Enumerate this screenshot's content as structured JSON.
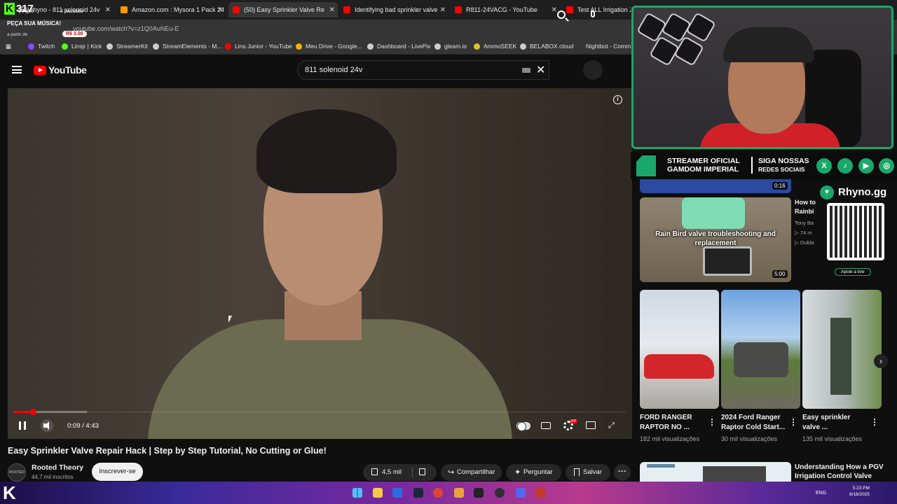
{
  "browser": {
    "tabs": [
      {
        "label": "(50) rhyno - 811 solenoid 24v",
        "color": "#ff0000"
      },
      {
        "label": "Amazon.com : Mysora 1 Pack 24",
        "color": "#ff9900"
      },
      {
        "label": "(50) Easy Sprinkler Valve Re",
        "color": "#ff0000"
      },
      {
        "label": "Identifying bad sprinkler valve",
        "color": "#ff0000"
      },
      {
        "label": "R811-24VACG - YouTube",
        "color": "#ff0000"
      },
      {
        "label": "Test ALL Irrigation Zo",
        "color": "#ff0000"
      }
    ],
    "url": "youtube.com/watch?v=z1Q0AuNEu-E",
    "bookmarks": [
      {
        "label": "Twitch",
        "color": "#9146ff"
      },
      {
        "label": "Linsjr | Kick",
        "color": "#53fc18"
      },
      {
        "label": "StreamerKit",
        "color": "#cccccc"
      },
      {
        "label": "StreamElements - M...",
        "color": "#cccccc"
      },
      {
        "label": "Lins Junior - YouTube",
        "color": "#ff0000"
      },
      {
        "label": "Meu Drive - Google...",
        "color": "#f4b400"
      },
      {
        "label": "Dashboard - LivePix",
        "color": "#cccccc"
      },
      {
        "label": "gleam.io",
        "color": "#cccccc"
      },
      {
        "label": "AmmoSEEK",
        "color": "#d8c22a"
      },
      {
        "label": "BELABOX cloud",
        "color": "#cccccc"
      },
      {
        "label": "Nightbot - Comm",
        "color": "#333333"
      }
    ]
  },
  "overlay": {
    "kick_count": "317",
    "kick_letter": "K",
    "rhyno": "Rhyno",
    "paused": "II pausado",
    "peca": "PEÇA SUA MÚSICA!",
    "a_partir": "a partir de",
    "preco": "R$ 3.00"
  },
  "youtube": {
    "logo_text": "YouTube",
    "search_value": "811 solenoid 24v"
  },
  "player": {
    "time": "0:09 / 4:43",
    "progress_fraction": 0.032,
    "title": "Easy Sprinkler Valve Repair Hack | Step by Step Tutorial, No Cutting or Glue!",
    "channel": "Rooted Theory",
    "channel_avatar": "ROOTED",
    "subs": "44,7 mil inscritos",
    "subscribe": "Inscrever-se",
    "likes": "4,5 mil",
    "share": "Compartilhar",
    "ask": "Perguntar",
    "save": "Salvar",
    "more": "···"
  },
  "stream_banner": {
    "line1": "STREAMER OFICIAL",
    "line2": "GAMDOM IMPERIAL",
    "line3": "SIGA NOSSAS",
    "line4": "REDES SOCIAIS",
    "socials": [
      "X",
      "♪",
      "▶",
      "◎"
    ]
  },
  "rhyno_box": {
    "brand": "Rhyno.gg",
    "heart": "♥",
    "cta": "Apoie a live"
  },
  "sidebar": {
    "top_duration": "0:16",
    "video2": {
      "caption": "Rain Bird valve troubleshooting and replacement",
      "duration": "5:00",
      "title_l1": "How to",
      "title_l2": "Rainbi",
      "meta_l1": "Tony Ba",
      "meta_l2": "▷ 74 m",
      "meta_l3": "▷ Dubla"
    },
    "shorts": [
      {
        "title_l1": "FORD RANGER",
        "title_l2": "RAPTOR NO ...",
        "views": "182 mil visualizações"
      },
      {
        "title_l1": "2024 Ford Ranger",
        "title_l2": "Raptor Cold Start...",
        "views": "30 mil visualizações"
      },
      {
        "title_l1": "Easy sprinkler",
        "title_l2": "valve ...",
        "views": "135 mil visualizações"
      }
    ],
    "bottom": {
      "title_l1": "Understanding How a PGV",
      "title_l2": "Irrigation Control Valve"
    }
  },
  "taskbar": {
    "k": "K",
    "lang": "ENG",
    "time_l1": "5:23 PM",
    "time_l2": "8/18/2025"
  }
}
